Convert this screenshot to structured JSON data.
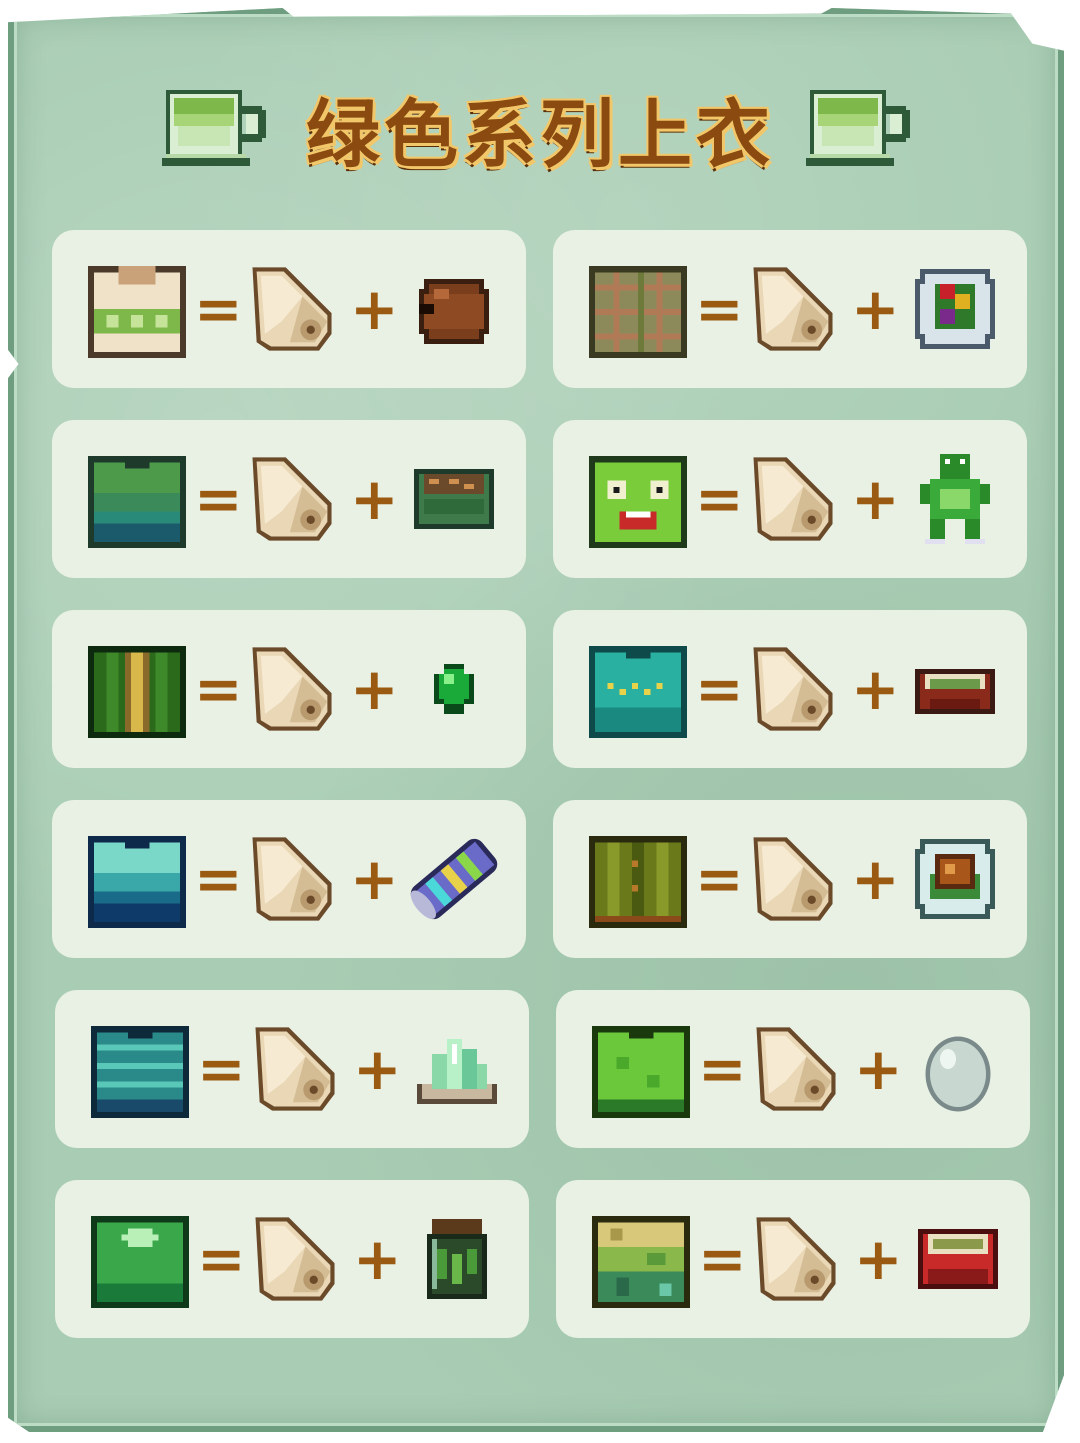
{
  "title": "绿色系列上衣",
  "equals_symbol": "=",
  "plus_symbol": "+",
  "icons": {
    "left_title_icon": "green-tea-cup-icon",
    "right_title_icon": "green-tea-cup-icon",
    "fabric": "cloth-roll-icon"
  },
  "colors": {
    "background": "#a9cdb4",
    "card": "#e9f1e4",
    "title_text": "#8a4a10",
    "title_outline": "#f2c76a",
    "operator": "#9a5a12"
  },
  "recipes": [
    {
      "shirt_icon": "cream-green-zigzag-shirt-icon",
      "ingredient_icon": "brown-pot-icon"
    },
    {
      "shirt_icon": "brown-green-plaid-shirt-icon",
      "ingredient_icon": "salad-plate-icon"
    },
    {
      "shirt_icon": "green-teal-gradient-shirt-icon",
      "ingredient_icon": "green-bowl-icon"
    },
    {
      "shirt_icon": "frog-face-shirt-icon",
      "ingredient_icon": "green-frog-icon"
    },
    {
      "shirt_icon": "dark-green-yellow-stripe-shirt-icon",
      "ingredient_icon": "emerald-gem-icon"
    },
    {
      "shirt_icon": "teal-yellow-zigzag-shirt-icon",
      "ingredient_icon": "green-soup-bowl-icon"
    },
    {
      "shirt_icon": "teal-gradient-shirt-icon",
      "ingredient_icon": "prismatic-roll-icon"
    },
    {
      "shirt_icon": "olive-jacket-shirt-icon",
      "ingredient_icon": "roasted-dish-plate-icon"
    },
    {
      "shirt_icon": "teal-stripe-shirt-icon",
      "ingredient_icon": "crystal-cluster-icon"
    },
    {
      "shirt_icon": "lime-green-shirt-icon",
      "ingredient_icon": "pale-egg-icon"
    },
    {
      "shirt_icon": "green-diamond-shirt-icon",
      "ingredient_icon": "pickle-jar-icon"
    },
    {
      "shirt_icon": "yellow-green-camo-shirt-icon",
      "ingredient_icon": "red-soup-bowl-icon"
    }
  ]
}
